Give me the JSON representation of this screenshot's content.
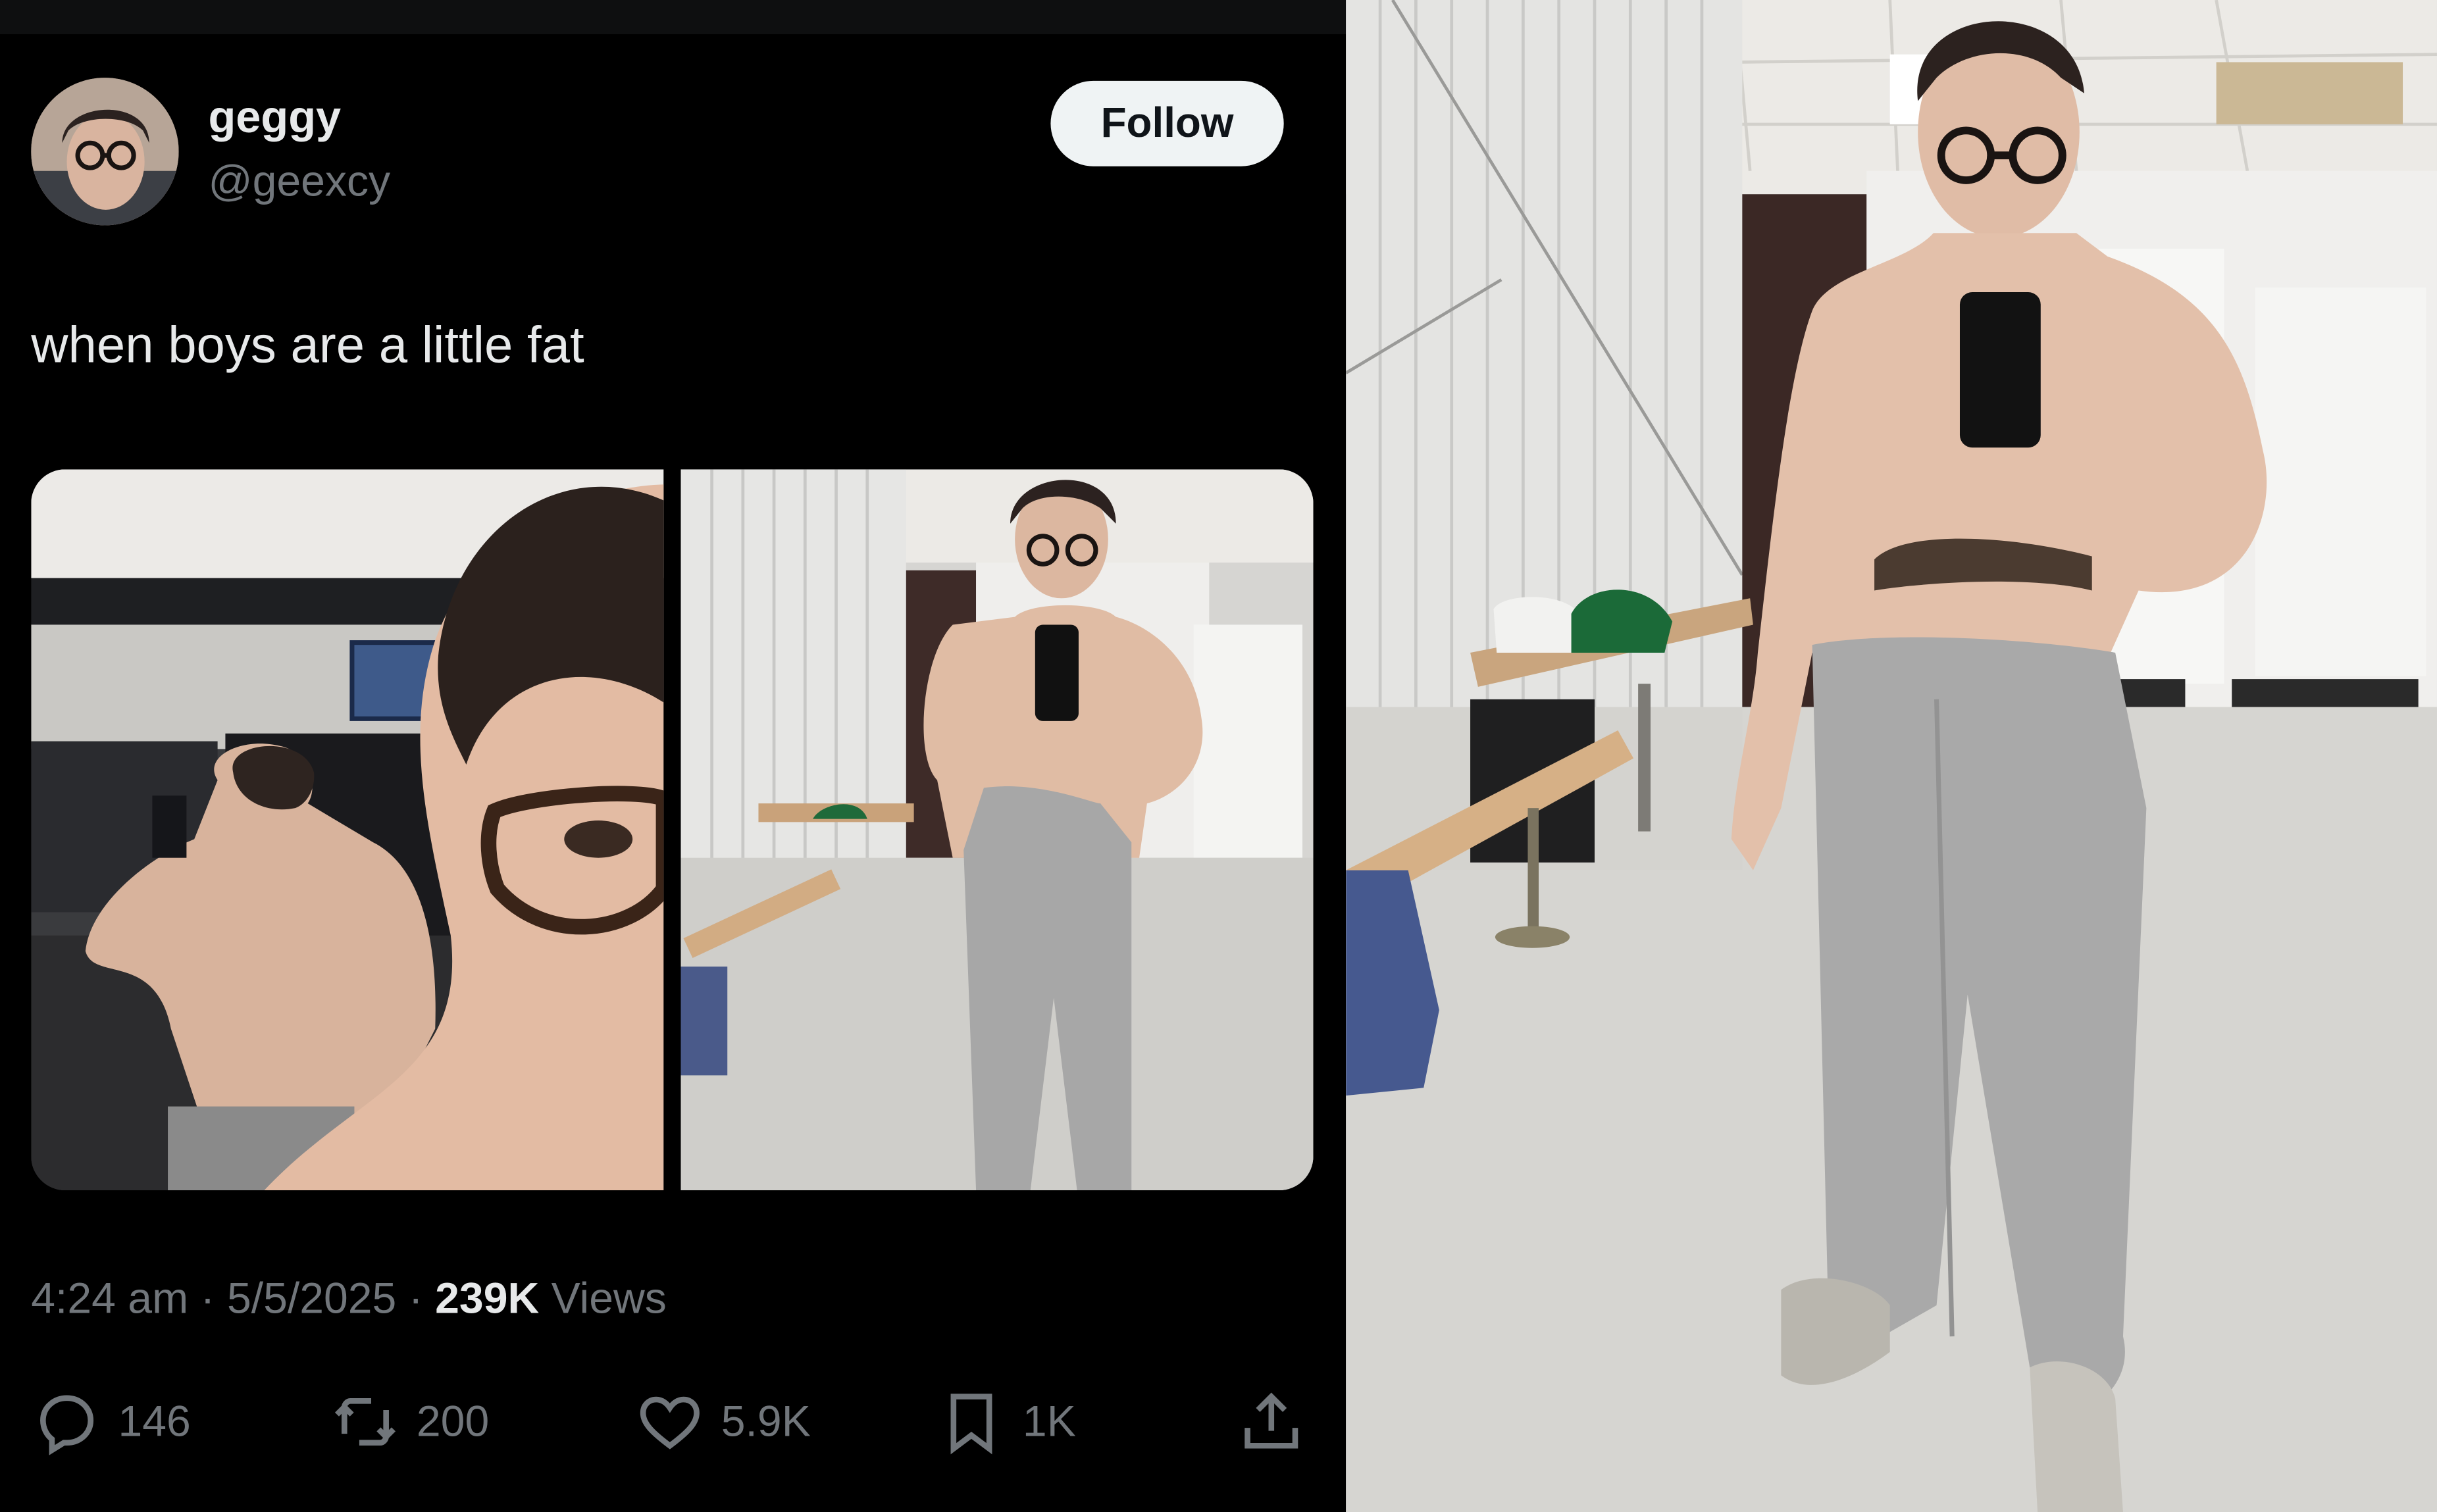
{
  "tweet": {
    "author": {
      "name": "geggy",
      "handle": "@geexcy"
    },
    "follow_label": "Follow",
    "text": "when boys are a little fat",
    "meta": {
      "time": "4:24 am",
      "sep1": " · ",
      "date": "5/5/2025",
      "sep2": " · ",
      "views_count": "239K",
      "views_label": " Views"
    },
    "actions": {
      "reply_count": "146",
      "retweet_count": "200",
      "like_count": "5.9K",
      "bookmark_count": "1K"
    }
  },
  "icons": [
    "avatar",
    "reply-icon",
    "retweet-icon",
    "like-icon",
    "bookmark-icon",
    "share-icon"
  ],
  "colors": {
    "background": "#000000",
    "text_primary": "#e7e9ea",
    "text_secondary": "#71767b",
    "follow_button_bg": "#eff3f4"
  }
}
